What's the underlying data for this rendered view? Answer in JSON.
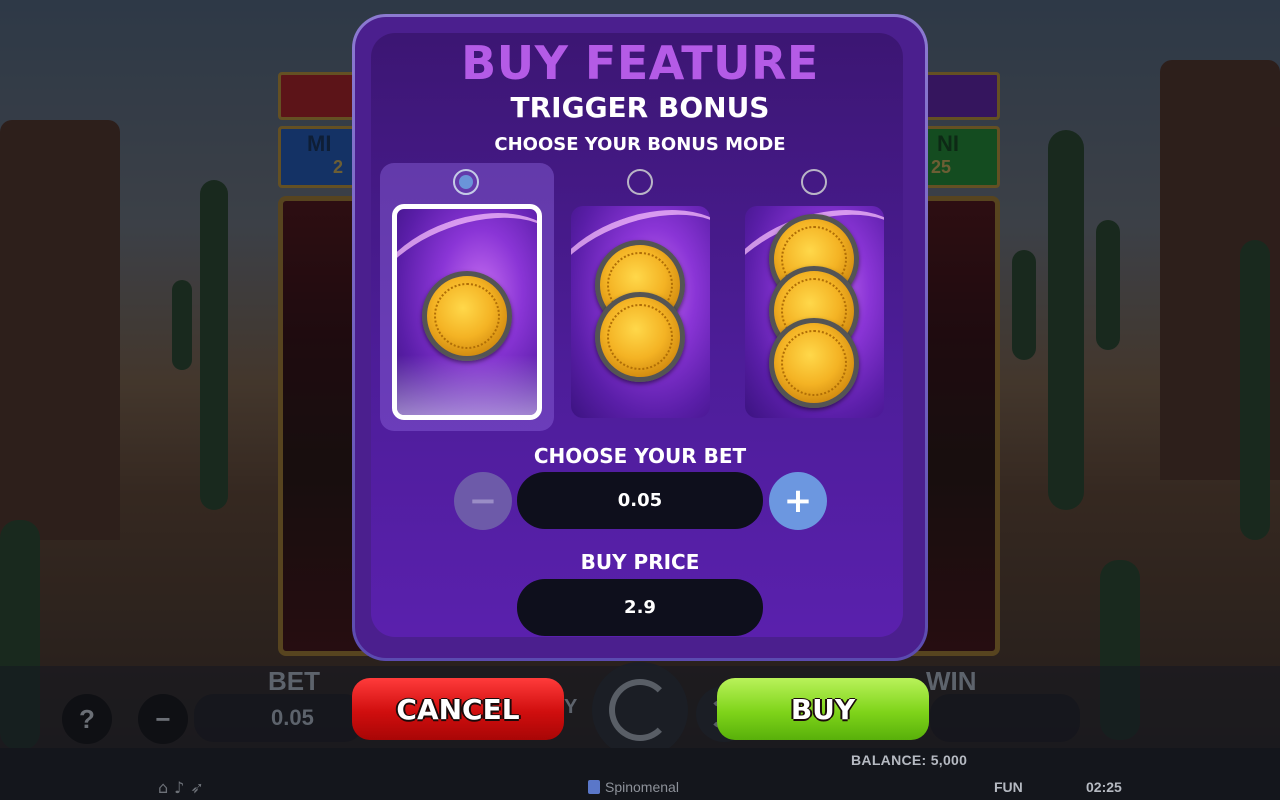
{
  "modal": {
    "title": "BUY FEATURE",
    "subtitle": "TRIGGER BONUS",
    "mode_label": "CHOOSE YOUR BONUS MODE",
    "modes": [
      {
        "coins": 1,
        "selected": true
      },
      {
        "coins": 2,
        "selected": false
      },
      {
        "coins": 3,
        "selected": false
      }
    ],
    "bet_label": "CHOOSE YOUR BET",
    "bet_value": "0.05",
    "minus_symbol": "−",
    "plus_symbol": "+",
    "price_label": "BUY PRICE",
    "price_value": "2.9"
  },
  "actions": {
    "cancel": "CANCEL",
    "buy": "BUY"
  },
  "hud": {
    "bet_label": "BET",
    "bet_value": "0.05",
    "win_label": "WIN",
    "help_symbol": "?",
    "minus_symbol": "−",
    "partial_y": "Y",
    "partial_jackpot_left": "MI",
    "partial_jackpot_right": "NI",
    "partial_jackpot_left_value": "2",
    "partial_jackpot_right_value": "25"
  },
  "footer": {
    "balance": "BALANCE: 5,000",
    "brand": "Spinomenal",
    "mode": "FUN",
    "clock": "02:25"
  },
  "colors": {
    "title_purple": "#b45be6",
    "cancel_red": "#d00e0e",
    "buy_green": "#7fd41a",
    "plus_blue": "#6c97e0",
    "radio_selected": "#6a94d9"
  }
}
